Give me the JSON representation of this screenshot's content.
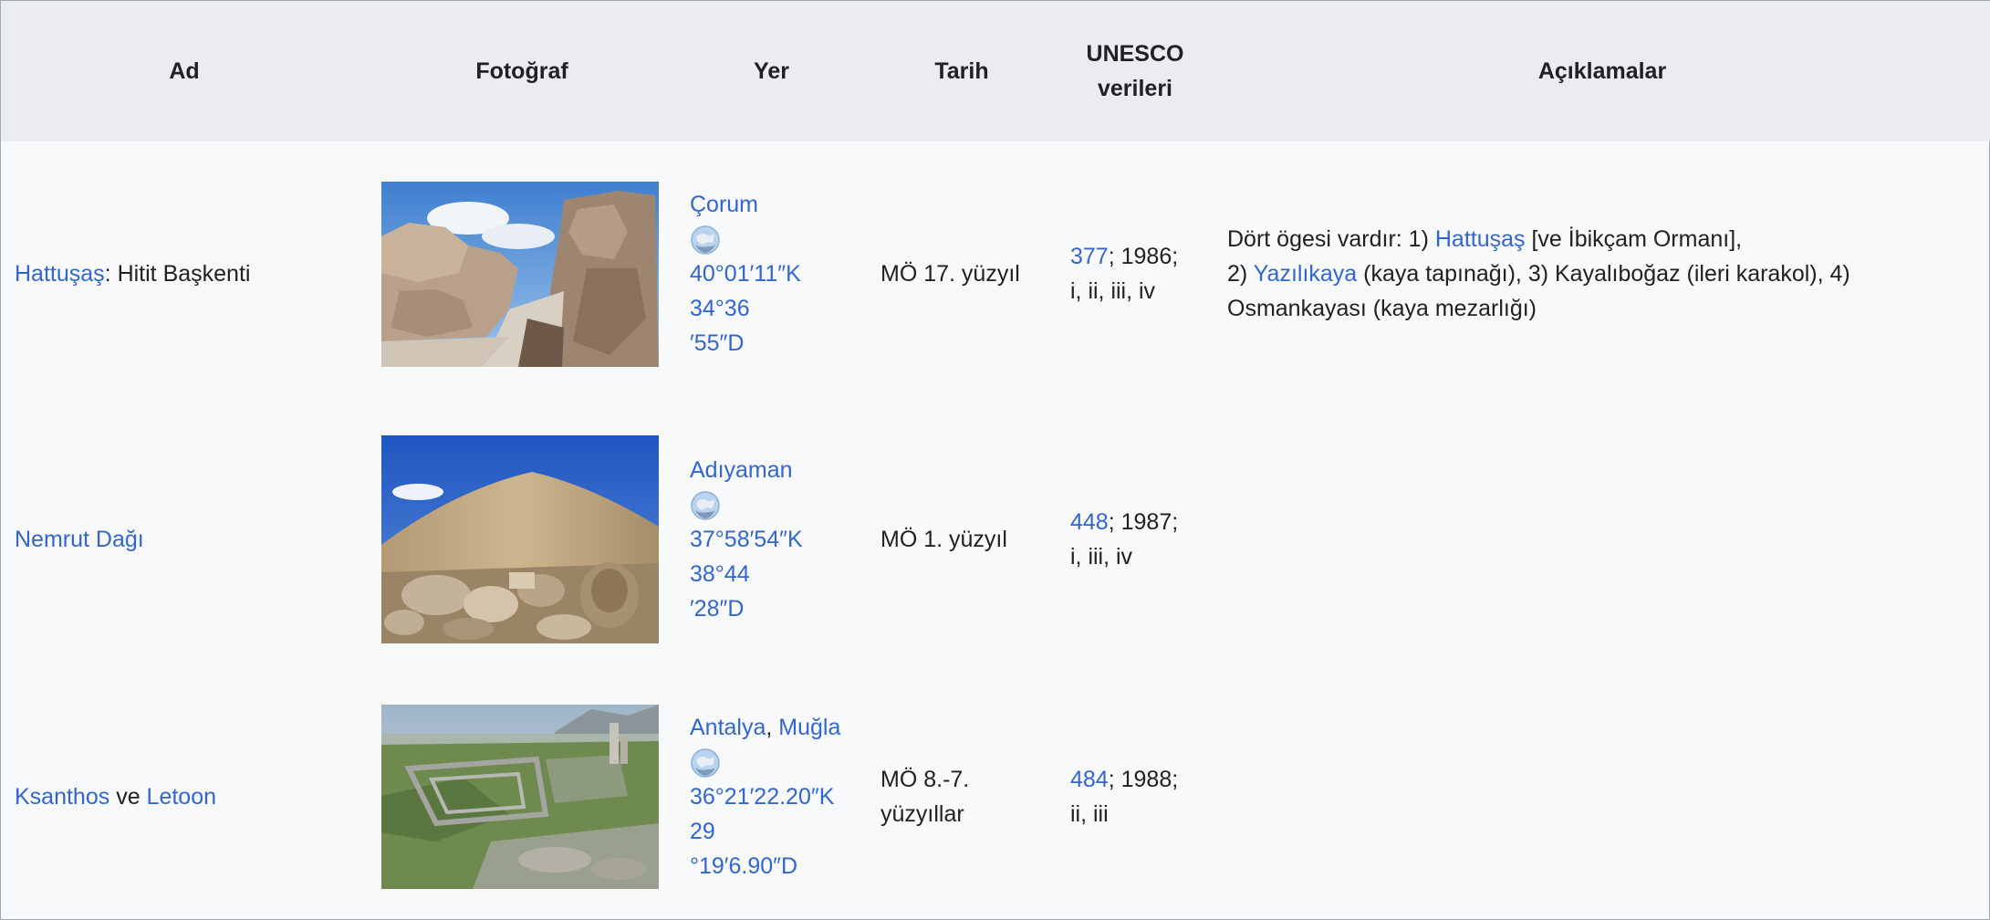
{
  "table": {
    "headers": {
      "name": "Ad",
      "photo": "Fotoğraf",
      "location": "Yer",
      "date": "Tarih",
      "unesco_line1": "UNESCO",
      "unesco_line2": "verileri",
      "notes": "Açıklamalar"
    },
    "rows": [
      {
        "name_link": "Hattuşaş",
        "name_rest": ": Hitit Başkenti",
        "photo_icon": "hattusa-lion-gate-photo",
        "location_links": [
          "Çorum"
        ],
        "coord_line1": "40°01′11″K 34°36",
        "coord_line2": "′55″D",
        "date": "MÖ 17. yüzyıl",
        "unesco_id": "377",
        "unesco_year": "; 1986;",
        "unesco_criteria": "i, ii, iii, iv",
        "notes": {
          "p1": "Dört ögesi vardır: 1) ",
          "link1": "Hattuşaş",
          "p2": " [ve İbikçam Ormanı],",
          "p3": "2) ",
          "link2": "Yazılıkaya",
          "p4": " (kaya tapınağı), 3) Kayalıboğaz (ileri karakol), 4)",
          "p5": "Osmankayası (kaya mezarlığı)"
        }
      },
      {
        "name_link": "Nemrut Dağı",
        "photo_icon": "nemrut-mountain-photo",
        "location_links": [
          "Adıyaman"
        ],
        "coord_line1": "37°58′54″K 38°44",
        "coord_line2": "′28″D",
        "date": "MÖ 1. yüzyıl",
        "unesco_id": "448",
        "unesco_year": "; 1987;",
        "unesco_criteria": "i, iii, iv"
      },
      {
        "name_link": "Ksanthos",
        "name_mid": " ve ",
        "name_link2": "Letoon",
        "photo_icon": "xanthos-ruins-photo",
        "location_links": [
          "Antalya",
          "Muğla"
        ],
        "location_sep": ", ",
        "coord_line1": "36°21′22.20″K 29",
        "coord_line2": "°19′6.90″D",
        "date_line1": "MÖ 8.-7.",
        "date_line2": "yüzyıllar",
        "unesco_id": "484",
        "unesco_year": "; 1988;",
        "unesco_criteria": "ii, iii"
      }
    ]
  },
  "colors": {
    "link": "#3366cc",
    "header_bg": "#eaecf0",
    "body_bg": "#f8f9fa",
    "text": "#202122"
  }
}
